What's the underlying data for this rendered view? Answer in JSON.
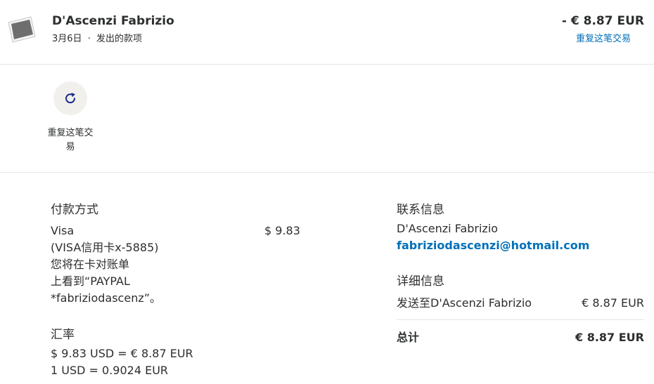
{
  "header": {
    "merchant": "D'Ascenzi Fabrizio",
    "date": "3月6日",
    "separator": "·",
    "type": "发出的款项",
    "amount": "- € 8.87 EUR",
    "repeat_link": "重复这笔交易"
  },
  "actions": {
    "repeat_label": "重复这笔交易"
  },
  "payment": {
    "title": "付款方式",
    "method_lines": [
      "Visa",
      "(VISA信用卡x-5885)",
      "您将在卡对账单",
      "上看到“PAYPAL",
      "*fabriziodascenz”。"
    ],
    "amount": "$ 9.83"
  },
  "exchange": {
    "title": "汇率",
    "line1": "$ 9.83 USD = € 8.87 EUR",
    "line2": "1 USD = 0.9024 EUR"
  },
  "contact": {
    "title": "联系信息",
    "name": "D'Ascenzi Fabrizio",
    "email": "fabriziodascenzi@hotmail.com"
  },
  "details": {
    "title": "详细信息",
    "sent_to_label": "发送至D'Ascenzi Fabrizio",
    "sent_to_amount": "€ 8.87 EUR",
    "total_label": "总计",
    "total_amount": "€ 8.87 EUR"
  },
  "colors": {
    "accent": "#0070ba",
    "text": "#2c2e2f",
    "divider": "#e5e5e5",
    "action_bg": "#f2f0ed"
  }
}
